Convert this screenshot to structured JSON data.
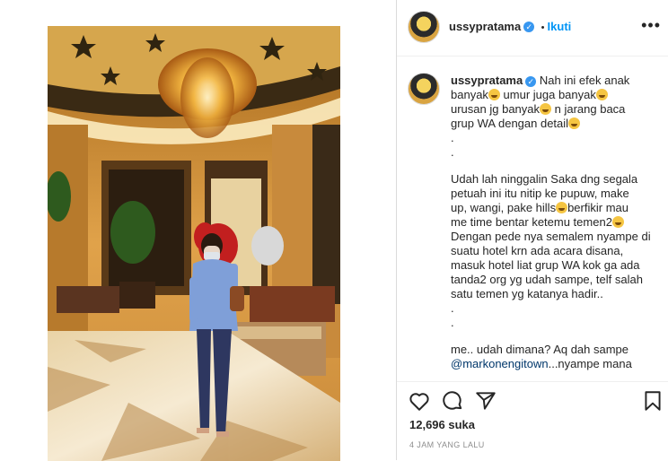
{
  "header": {
    "username": "ussypratama",
    "verified_icon": "verified-badge-icon",
    "separator": "•",
    "follow_label": "Ikuti",
    "more_icon": "more-options-icon"
  },
  "caption": {
    "username": "ussypratama",
    "line1": "Nah ini efek anak",
    "line2a": "banyak",
    "line2b": " umur juga banyak",
    "line3a": "urusan jg banyak",
    "line3b": " n jarang baca",
    "line4": "grup WA dengan detail",
    "dot1": ".",
    "dot2": ".",
    "para2a": "Udah lah ninggalin Saka dng segala\npetuah ini itu nitip ke pupuw, make\nup, wangi, pake hills",
    "para2b": "berfikir mau\nme time bentar ketemu temen2",
    "para3": "Dengan pede nya semalem nyampe di\nsuatu hotel krn ada acara disana,\nmasuk hotel liat grup WA kok ga ada\ntanda2 org yg udah sampe, telf salah\nsatu temen yg katanya hadir..",
    "dot3": ".",
    "dot4": ".",
    "para4": "me.. udah dimana? Aq dah sampe",
    "mention": "@markonengitown",
    "para4b": "...nyampe mana"
  },
  "actions": {
    "like_icon": "heart-icon",
    "comment_icon": "comment-icon",
    "share_icon": "send-icon",
    "save_icon": "bookmark-icon",
    "likes": "12,696 suka",
    "timestamp": "4 JAM YANG LALU"
  },
  "colors": {
    "accent": "#0095f6",
    "verified": "#3897f0",
    "text": "#262626",
    "muted": "#8e8e8e"
  }
}
